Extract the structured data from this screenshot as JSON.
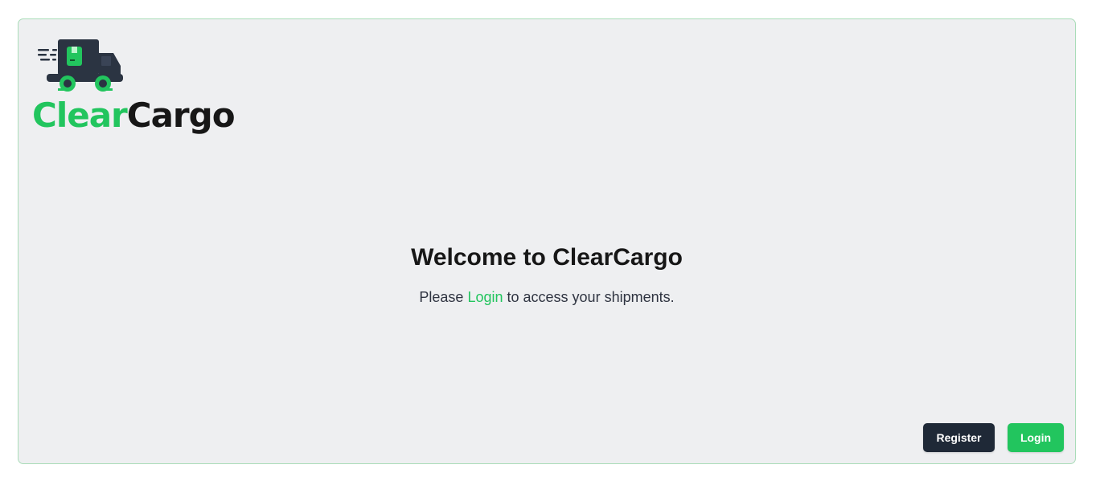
{
  "brand": {
    "part1": "Clear",
    "part2": "Cargo",
    "logo_icon": "delivery-truck-icon",
    "colors": {
      "green": "#22c55e",
      "dark": "#171717"
    }
  },
  "main": {
    "heading": "Welcome to ClearCargo",
    "message_prefix": "Please",
    "message_link": "Login",
    "message_suffix": "to access your shipments."
  },
  "actions": {
    "register_label": "Register",
    "login_label": "Login",
    "register_color": "#1f2937",
    "login_color": "#22c55e"
  }
}
